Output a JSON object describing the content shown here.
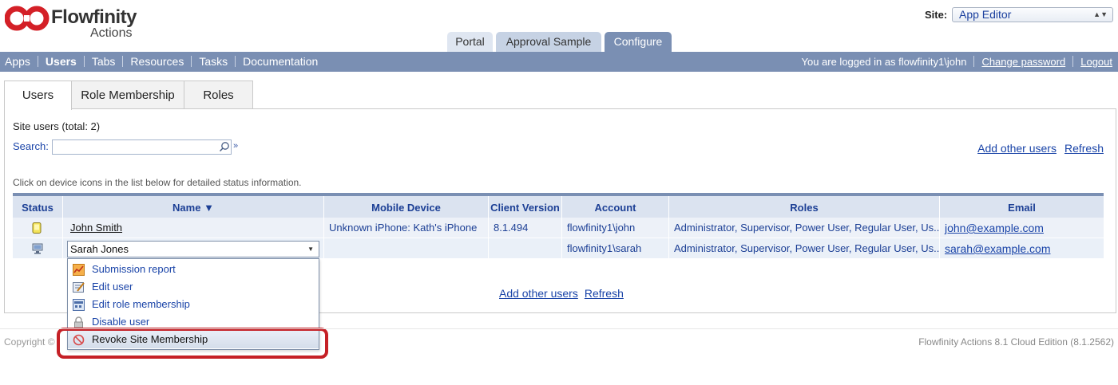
{
  "header": {
    "logo_word": "Flowfinity",
    "logo_sub": "Actions",
    "site_label": "Site:",
    "site_value": "App Editor"
  },
  "top_tabs": [
    {
      "label": "Portal"
    },
    {
      "label": "Approval Sample"
    },
    {
      "label": "Configure"
    }
  ],
  "nav": {
    "items": [
      "Apps",
      "Users",
      "Tabs",
      "Resources",
      "Tasks",
      "Documentation"
    ],
    "logged_in": "You are logged in as flowfinity1\\john",
    "change_password": "Change password",
    "logout": "Logout"
  },
  "sub_tabs": [
    {
      "label": "Users"
    },
    {
      "label": "Role Membership"
    },
    {
      "label": "Roles"
    }
  ],
  "main": {
    "site_users": "Site users (total: 2)",
    "search_label": "Search:",
    "search_value": "",
    "add_other_users": "Add other users",
    "refresh": "Refresh",
    "hint": "Click on device icons in the list below for detailed status information."
  },
  "table": {
    "columns": [
      "Status",
      "Name ▼",
      "Mobile Device",
      "Client Version",
      "Account",
      "Roles",
      "Email"
    ],
    "rows": [
      {
        "name": "John Smith",
        "mobile_device": "Unknown iPhone: Kath's iPhone",
        "client_version": "8.1.494",
        "account": "flowfinity1\\john",
        "roles": "Administrator, Supervisor, Power User, Regular User, Us...",
        "email": "john@example.com"
      },
      {
        "name": "Sarah Jones",
        "mobile_device": "",
        "client_version": "",
        "account": "flowfinity1\\sarah",
        "roles": "Administrator, Supervisor, Power User, Regular User, Us...",
        "email": "sarah@example.com"
      }
    ]
  },
  "dropdown": {
    "selected": "Sarah Jones",
    "items": [
      {
        "label": "Submission report",
        "icon": "submission-report-icon"
      },
      {
        "label": "Edit user",
        "icon": "edit-user-icon"
      },
      {
        "label": "Edit role membership",
        "icon": "edit-role-membership-icon"
      },
      {
        "label": "Disable user",
        "icon": "lock-icon"
      },
      {
        "label": "Revoke Site Membership",
        "icon": "prohibited-icon"
      }
    ]
  },
  "bottom": {
    "add_other_users": "Add other users",
    "refresh": "Refresh"
  },
  "footer": {
    "copyright": "Copyright ©",
    "version": "Flowfinity Actions 8.1 Cloud Edition (8.1.2562)"
  },
  "colors": {
    "brand_red": "#d42027",
    "nav_bar": "#7a8fb3",
    "link": "#1a44a8",
    "highlight_ring": "#c52026"
  }
}
